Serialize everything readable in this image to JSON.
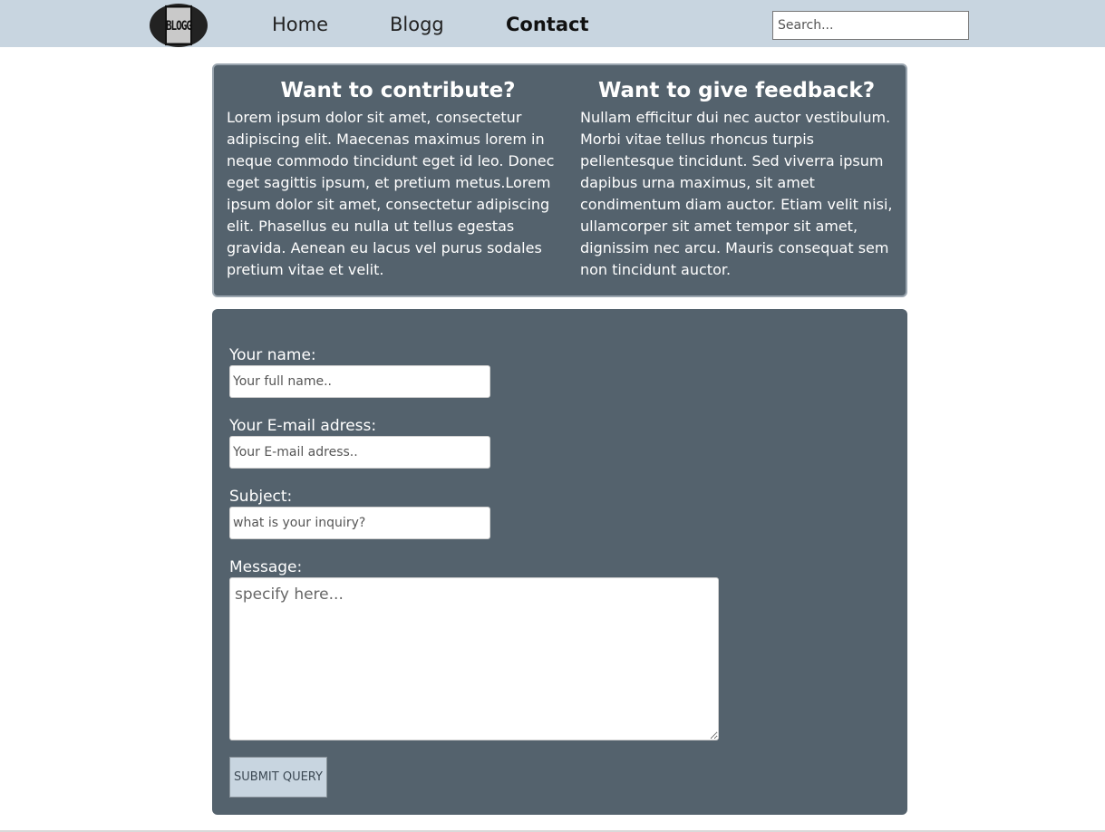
{
  "nav": {
    "logo_text": "BLOGG",
    "links": [
      {
        "label": "Home"
      },
      {
        "label": "Blogg"
      },
      {
        "label": "Contact"
      }
    ],
    "search_placeholder": "Search..."
  },
  "info": {
    "contribute": {
      "title": "Want to contribute?",
      "text": "Lorem ipsum dolor sit amet, consectetur adipiscing elit. Maecenas maximus lorem in neque commodo tincidunt eget id leo. Donec eget sagittis ipsum, et pretium metus.Lorem ipsum dolor sit amet, consectetur adipiscing elit. Phasellus eu nulla ut tellus egestas gravida. Aenean eu lacus vel purus sodales pretium vitae et velit."
    },
    "feedback": {
      "title": "Want to give feedback?",
      "text": "Nullam efficitur dui nec auctor vestibulum. Morbi vitae tellus rhoncus turpis pellentesque tincidunt. Sed viverra ipsum dapibus urna maximus, sit amet condimentum diam auctor. Etiam velit nisi, ullamcorper sit amet tempor sit amet, dignissim nec arcu. Mauris consequat sem non tincidunt auctor."
    }
  },
  "form": {
    "name_label": "Your name:",
    "name_placeholder": "Your full name..",
    "email_label": "Your E-mail adress:",
    "email_placeholder": "Your E-mail adress..",
    "subject_label": "Subject:",
    "subject_placeholder": "what is your inquiry?",
    "message_label": "Message:",
    "message_placeholder": "specify here...",
    "submit_label": "SUBMIT QUERY"
  },
  "colors": {
    "navbar": "#c8d5e0",
    "panel": "#54626d",
    "button": "#c8d5e0"
  }
}
